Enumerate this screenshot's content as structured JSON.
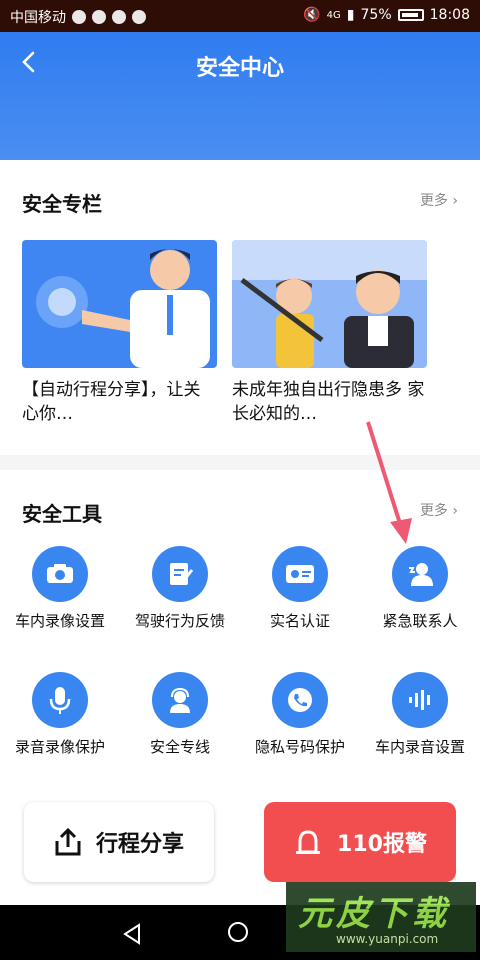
{
  "status_bar": {
    "carrier": "中国移动",
    "signal_label": "4G",
    "battery": "75%",
    "time": "18:08"
  },
  "header": {
    "title": "安全中心"
  },
  "safety_column": {
    "title": "安全专栏",
    "more": "更多",
    "articles": [
      {
        "title": "【自动行程分享】，让关心你…"
      },
      {
        "title": "未成年独自出行隐患多 家长必知的…"
      }
    ]
  },
  "safety_tools": {
    "title": "安全工具",
    "more": "更多",
    "items": [
      {
        "label": "车内录像设置",
        "icon": "camera-record-icon"
      },
      {
        "label": "驾驶行为反馈",
        "icon": "feedback-edit-icon"
      },
      {
        "label": "实名认证",
        "icon": "id-card-icon"
      },
      {
        "label": "紧急联系人",
        "icon": "emergency-contact-icon"
      },
      {
        "label": "录音录像保护",
        "icon": "microphone-icon"
      },
      {
        "label": "安全专线",
        "icon": "headset-agent-icon"
      },
      {
        "label": "隐私号码保护",
        "icon": "phone-shield-icon"
      },
      {
        "label": "车内录音设置",
        "icon": "audio-wave-icon"
      }
    ]
  },
  "actions": {
    "share_label": "行程分享",
    "alarm_label": "110报警"
  },
  "watermark": {
    "main": "元皮下载",
    "url": "www.yuanpi.com"
  },
  "colors": {
    "primary": "#3a86f0",
    "alarm": "#f24d4f"
  }
}
